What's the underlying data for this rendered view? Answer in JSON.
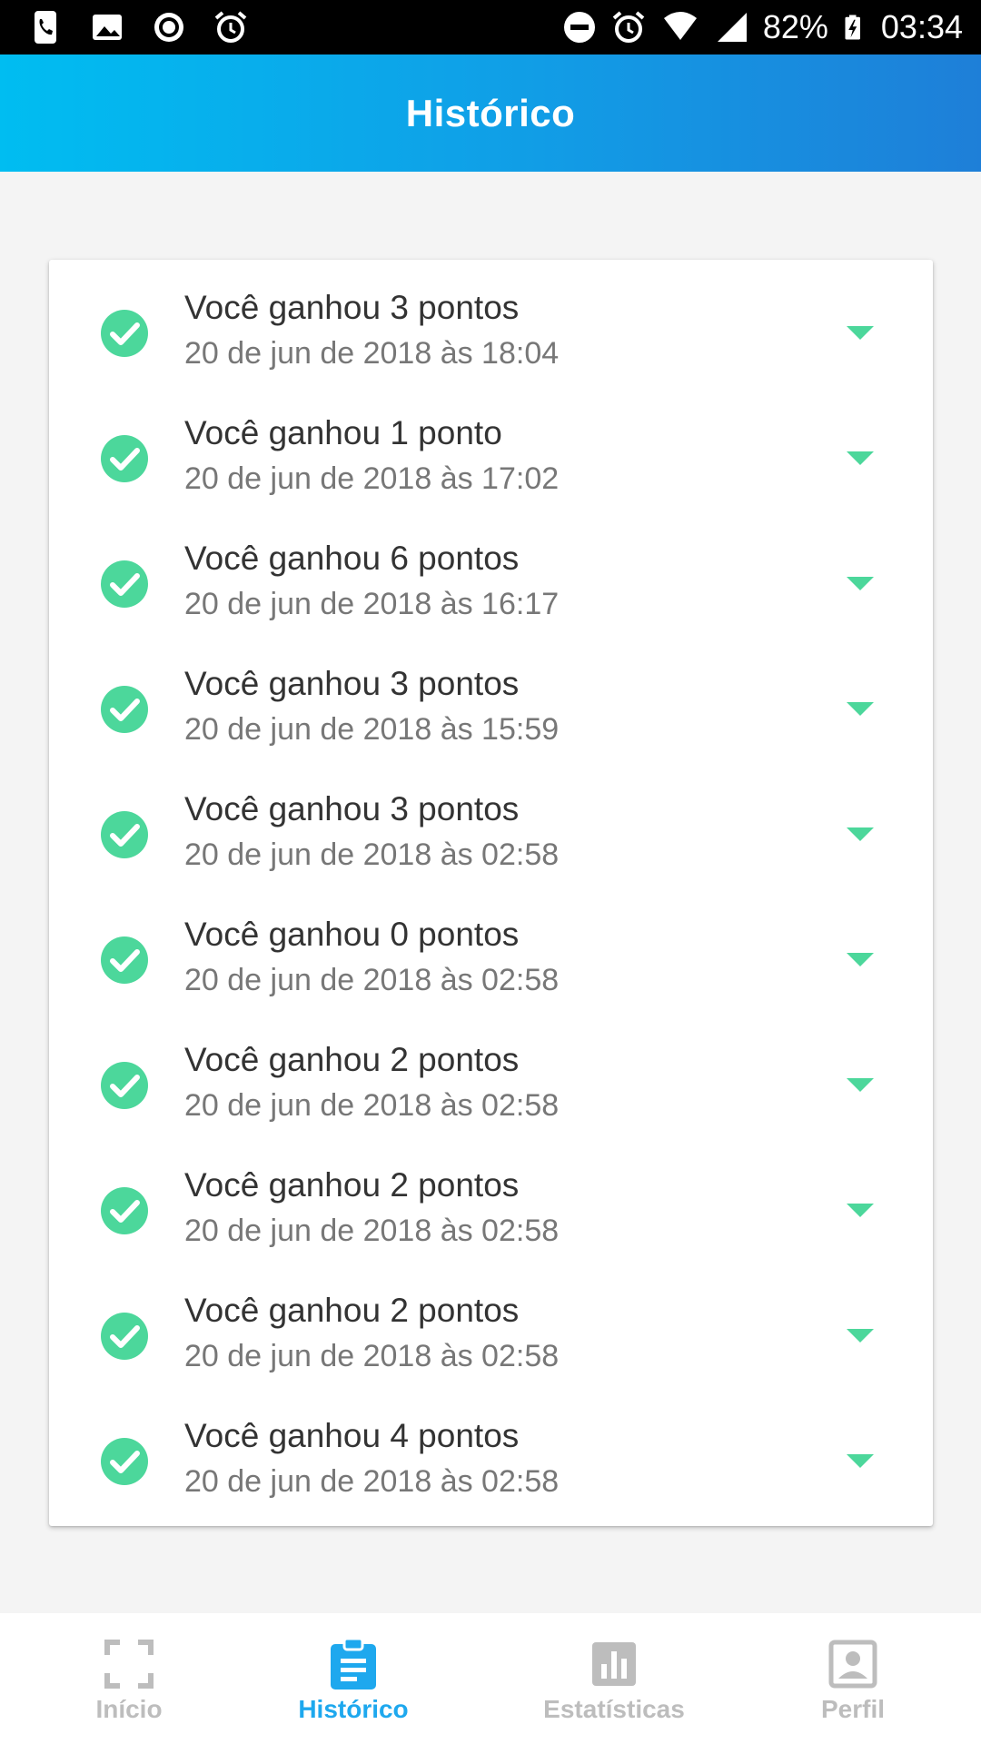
{
  "status_bar": {
    "battery": "82%",
    "time": "03:34"
  },
  "app_bar": {
    "title": "Histórico"
  },
  "history": {
    "items": [
      {
        "title": "Você ganhou 3 pontos",
        "date": "20 de jun de 2018 às 18:04"
      },
      {
        "title": "Você ganhou 1 ponto",
        "date": "20 de jun de 2018 às 17:02"
      },
      {
        "title": "Você ganhou 6 pontos",
        "date": "20 de jun de 2018 às 16:17"
      },
      {
        "title": "Você ganhou 3 pontos",
        "date": "20 de jun de 2018 às 15:59"
      },
      {
        "title": "Você ganhou 3 pontos",
        "date": "20 de jun de 2018 às 02:58"
      },
      {
        "title": "Você ganhou 0 pontos",
        "date": "20 de jun de 2018 às 02:58"
      },
      {
        "title": "Você ganhou 2 pontos",
        "date": "20 de jun de 2018 às 02:58"
      },
      {
        "title": "Você ganhou 2 pontos",
        "date": "20 de jun de 2018 às 02:58"
      },
      {
        "title": "Você ganhou 2 pontos",
        "date": "20 de jun de 2018 às 02:58"
      },
      {
        "title": "Você ganhou 4 pontos",
        "date": "20 de jun de 2018 às 02:58"
      }
    ]
  },
  "bottom_nav": {
    "items": [
      {
        "label": "Início",
        "icon": "scan-frame-icon",
        "active": false
      },
      {
        "label": "Histórico",
        "icon": "clipboard-icon",
        "active": true
      },
      {
        "label": "Estatísticas",
        "icon": "bar-chart-icon",
        "active": false
      },
      {
        "label": "Perfil",
        "icon": "profile-icon",
        "active": false
      }
    ]
  },
  "colors": {
    "accent": "#1ea8ee",
    "success": "#4cd79b",
    "inactive": "#bdbdbd",
    "app_bar_start": "#00bdf1",
    "app_bar_end": "#1e7fd8"
  }
}
